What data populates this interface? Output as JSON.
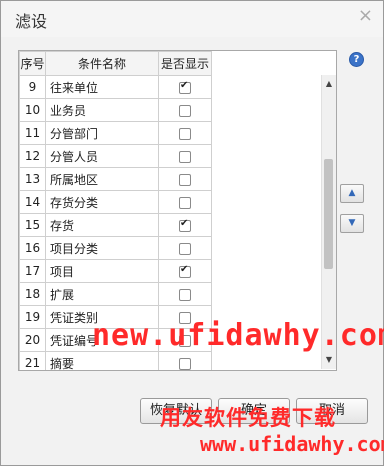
{
  "dialog": {
    "title": "滤设",
    "close_label": "×",
    "help_label": "?"
  },
  "table": {
    "headers": [
      "序号",
      "条件名称",
      "是否显示"
    ],
    "rows": [
      {
        "no": "9",
        "name": "往来单位",
        "checked": true
      },
      {
        "no": "10",
        "name": "业务员",
        "checked": false
      },
      {
        "no": "11",
        "name": "分管部门",
        "checked": false
      },
      {
        "no": "12",
        "name": "分管人员",
        "checked": false
      },
      {
        "no": "13",
        "name": "所属地区",
        "checked": false
      },
      {
        "no": "14",
        "name": "存货分类",
        "checked": false
      },
      {
        "no": "15",
        "name": "存货",
        "checked": true
      },
      {
        "no": "16",
        "name": "项目分类",
        "checked": false
      },
      {
        "no": "17",
        "name": "项目",
        "checked": true
      },
      {
        "no": "18",
        "name": "扩展",
        "checked": false
      },
      {
        "no": "19",
        "name": "凭证类别",
        "checked": false
      },
      {
        "no": "20",
        "name": "凭证编号",
        "checked": false
      },
      {
        "no": "21",
        "name": "摘要",
        "checked": false
      }
    ]
  },
  "side_buttons": {
    "up": "▲",
    "down": "▼"
  },
  "buttons": {
    "restore": "恢复默认",
    "ok": "确定",
    "cancel": "取消"
  },
  "watermark": {
    "line1": "new.ufidawhy.com",
    "line2": "用友软件免费下载",
    "line3": "www.ufidawhy.com"
  }
}
